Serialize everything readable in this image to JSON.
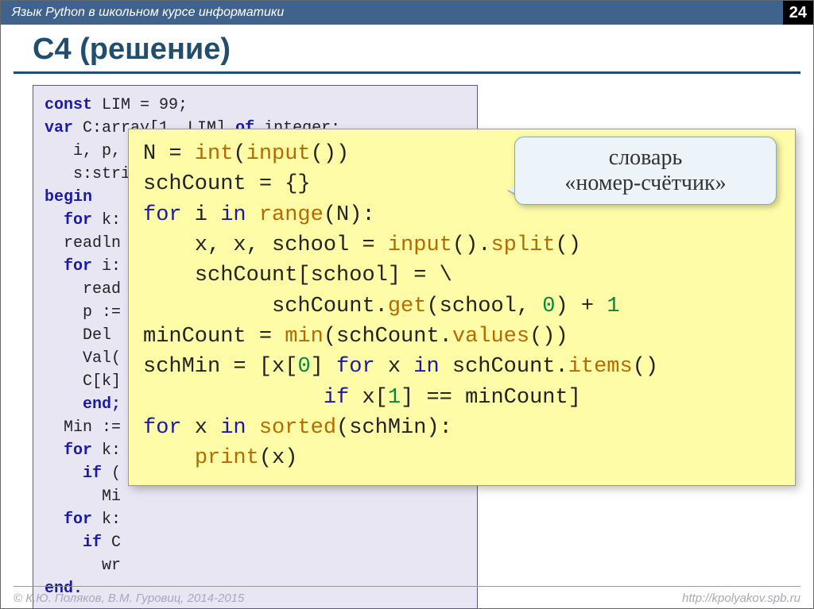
{
  "header": {
    "subtitle": "Язык Python в школьном курсе информатики",
    "pagenum": "24"
  },
  "title": "C4 (решение)",
  "pascal": {
    "l1a": "const",
    "l1b": " LIM = 99;",
    "l2a": "var",
    "l2b": " C:array[1..LIM] ",
    "l2c": "of",
    "l2d": " integer;",
    "l3": "   i, p,",
    "l4": "   s:stri",
    "l5": "begin",
    "l6a": "  for",
    "l6b": " k:",
    "l7": "  readln",
    "l8a": "  for",
    "l8b": " i:",
    "l9": "    read",
    "l10": "    p :=",
    "l11": "    Del",
    "l12": "    Val(",
    "l13": "    C[k]",
    "l14": "    end;",
    "l15": "  Min :=",
    "l16a": "  for",
    "l16b": " k:",
    "l17a": "    if",
    "l17b": " (",
    "l18": "      Mi",
    "l19a": "  for",
    "l19b": " k:",
    "l20a": "    if",
    "l20b": " C",
    "l21": "      wr",
    "l22": "end."
  },
  "python": {
    "l1a": "N = ",
    "l1b": "int",
    "l1c": "(",
    "l1d": "input",
    "l1e": "())",
    "l2": "schCount = {}",
    "l3a": "for",
    "l3b": " i ",
    "l3c": "in",
    "l3d": " ",
    "l3e": "range",
    "l3f": "(N):",
    "l4a": "    x, x, school = ",
    "l4b": "input",
    "l4c": "().",
    "l4d": "split",
    "l4e": "()",
    "l5": "    schCount[school] = \\",
    "l6a": "          schCount.",
    "l6b": "get",
    "l6c": "(school, ",
    "l6d": "0",
    "l6e": ") + ",
    "l6f": "1",
    "l7a": "minCount = ",
    "l7b": "min",
    "l7c": "(schCount.",
    "l7d": "values",
    "l7e": "())",
    "l8a": "schMin = [x[",
    "l8b": "0",
    "l8c": "] ",
    "l8d": "for",
    "l8e": " x ",
    "l8f": "in",
    "l8g": " schCount.",
    "l8h": "items",
    "l8i": "()",
    "l9a": "              ",
    "l9b": "if",
    "l9c": " x[",
    "l9d": "1",
    "l9e": "] == minCount]",
    "l10a": "for",
    "l10b": " x ",
    "l10c": "in",
    "l10d": " ",
    "l10e": "sorted",
    "l10f": "(schMin):",
    "l11a": "    ",
    "l11b": "print",
    "l11c": "(x)"
  },
  "callout": {
    "line1": "словарь",
    "line2": "«номер-счётчик»"
  },
  "footer": {
    "left": "© К.Ю. Поляков, В.М. Гуровиц, 2014-2015",
    "right": "http://kpolyakov.spb.ru"
  }
}
